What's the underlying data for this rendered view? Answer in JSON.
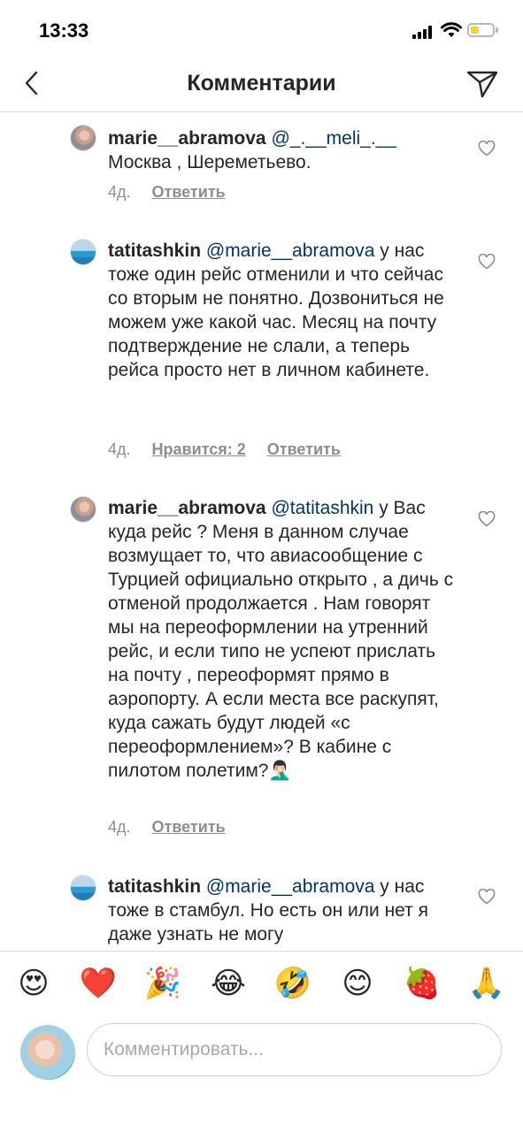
{
  "status": {
    "time": "13:33"
  },
  "header": {
    "title": "Комментарии"
  },
  "comments": [
    {
      "username": "marie__abramova",
      "mention": "@_.__meli_.__",
      "text": "Москва , Шереметьево.",
      "time": "4д.",
      "likes": "",
      "reply": "Ответить"
    },
    {
      "username": "tatitashkin",
      "mention": "@marie__abramova",
      "text": "у нас тоже один рейс отменили и что сейчас со вторым не понятно. Дозвониться не можем уже какой час. Месяц на почту подтверждение не слали, а теперь рейса просто нет в личном кабинете.",
      "time": "4д.",
      "likes": "Нравится: 2",
      "reply": "Ответить"
    },
    {
      "username": "marie__abramova",
      "mention": "@tatitashkin",
      "text": "у Вас куда рейс ? Меня в данном случае возмущает то, что  авиасообщение с Турцией официально открыто , а дичь с отменой  продолжается . Нам говорят мы на переоформлении на утренний рейс, и если типо не успеют прислать на почту , переоформят прямо в аэропорту. А если места все раскупят, куда сажать будут людей «с переоформлением»? В кабине с пилотом полетим?🤦🏻‍♂️",
      "time": "4д.",
      "likes": "",
      "reply": "Ответить"
    },
    {
      "username": "tatitashkin",
      "mention": "@marie__abramova",
      "text": "у нас тоже в стамбул. Но есть он или нет я даже узнать не могу",
      "time": "",
      "likes": "",
      "reply": ""
    }
  ],
  "emoji_bar": [
    "😍",
    "❤️",
    "🎉",
    "😂",
    "🤣",
    "😊",
    "🍓",
    "🙏"
  ],
  "input": {
    "placeholder": "Комментировать..."
  },
  "colors": {
    "mention": "#003569",
    "secondary": "#8e8e8e",
    "battery": "#f7d330"
  },
  "icons": [
    "back-arrow-icon",
    "send-icon",
    "heart-outline-icon",
    "signal-icon",
    "wifi-icon",
    "battery-icon"
  ]
}
